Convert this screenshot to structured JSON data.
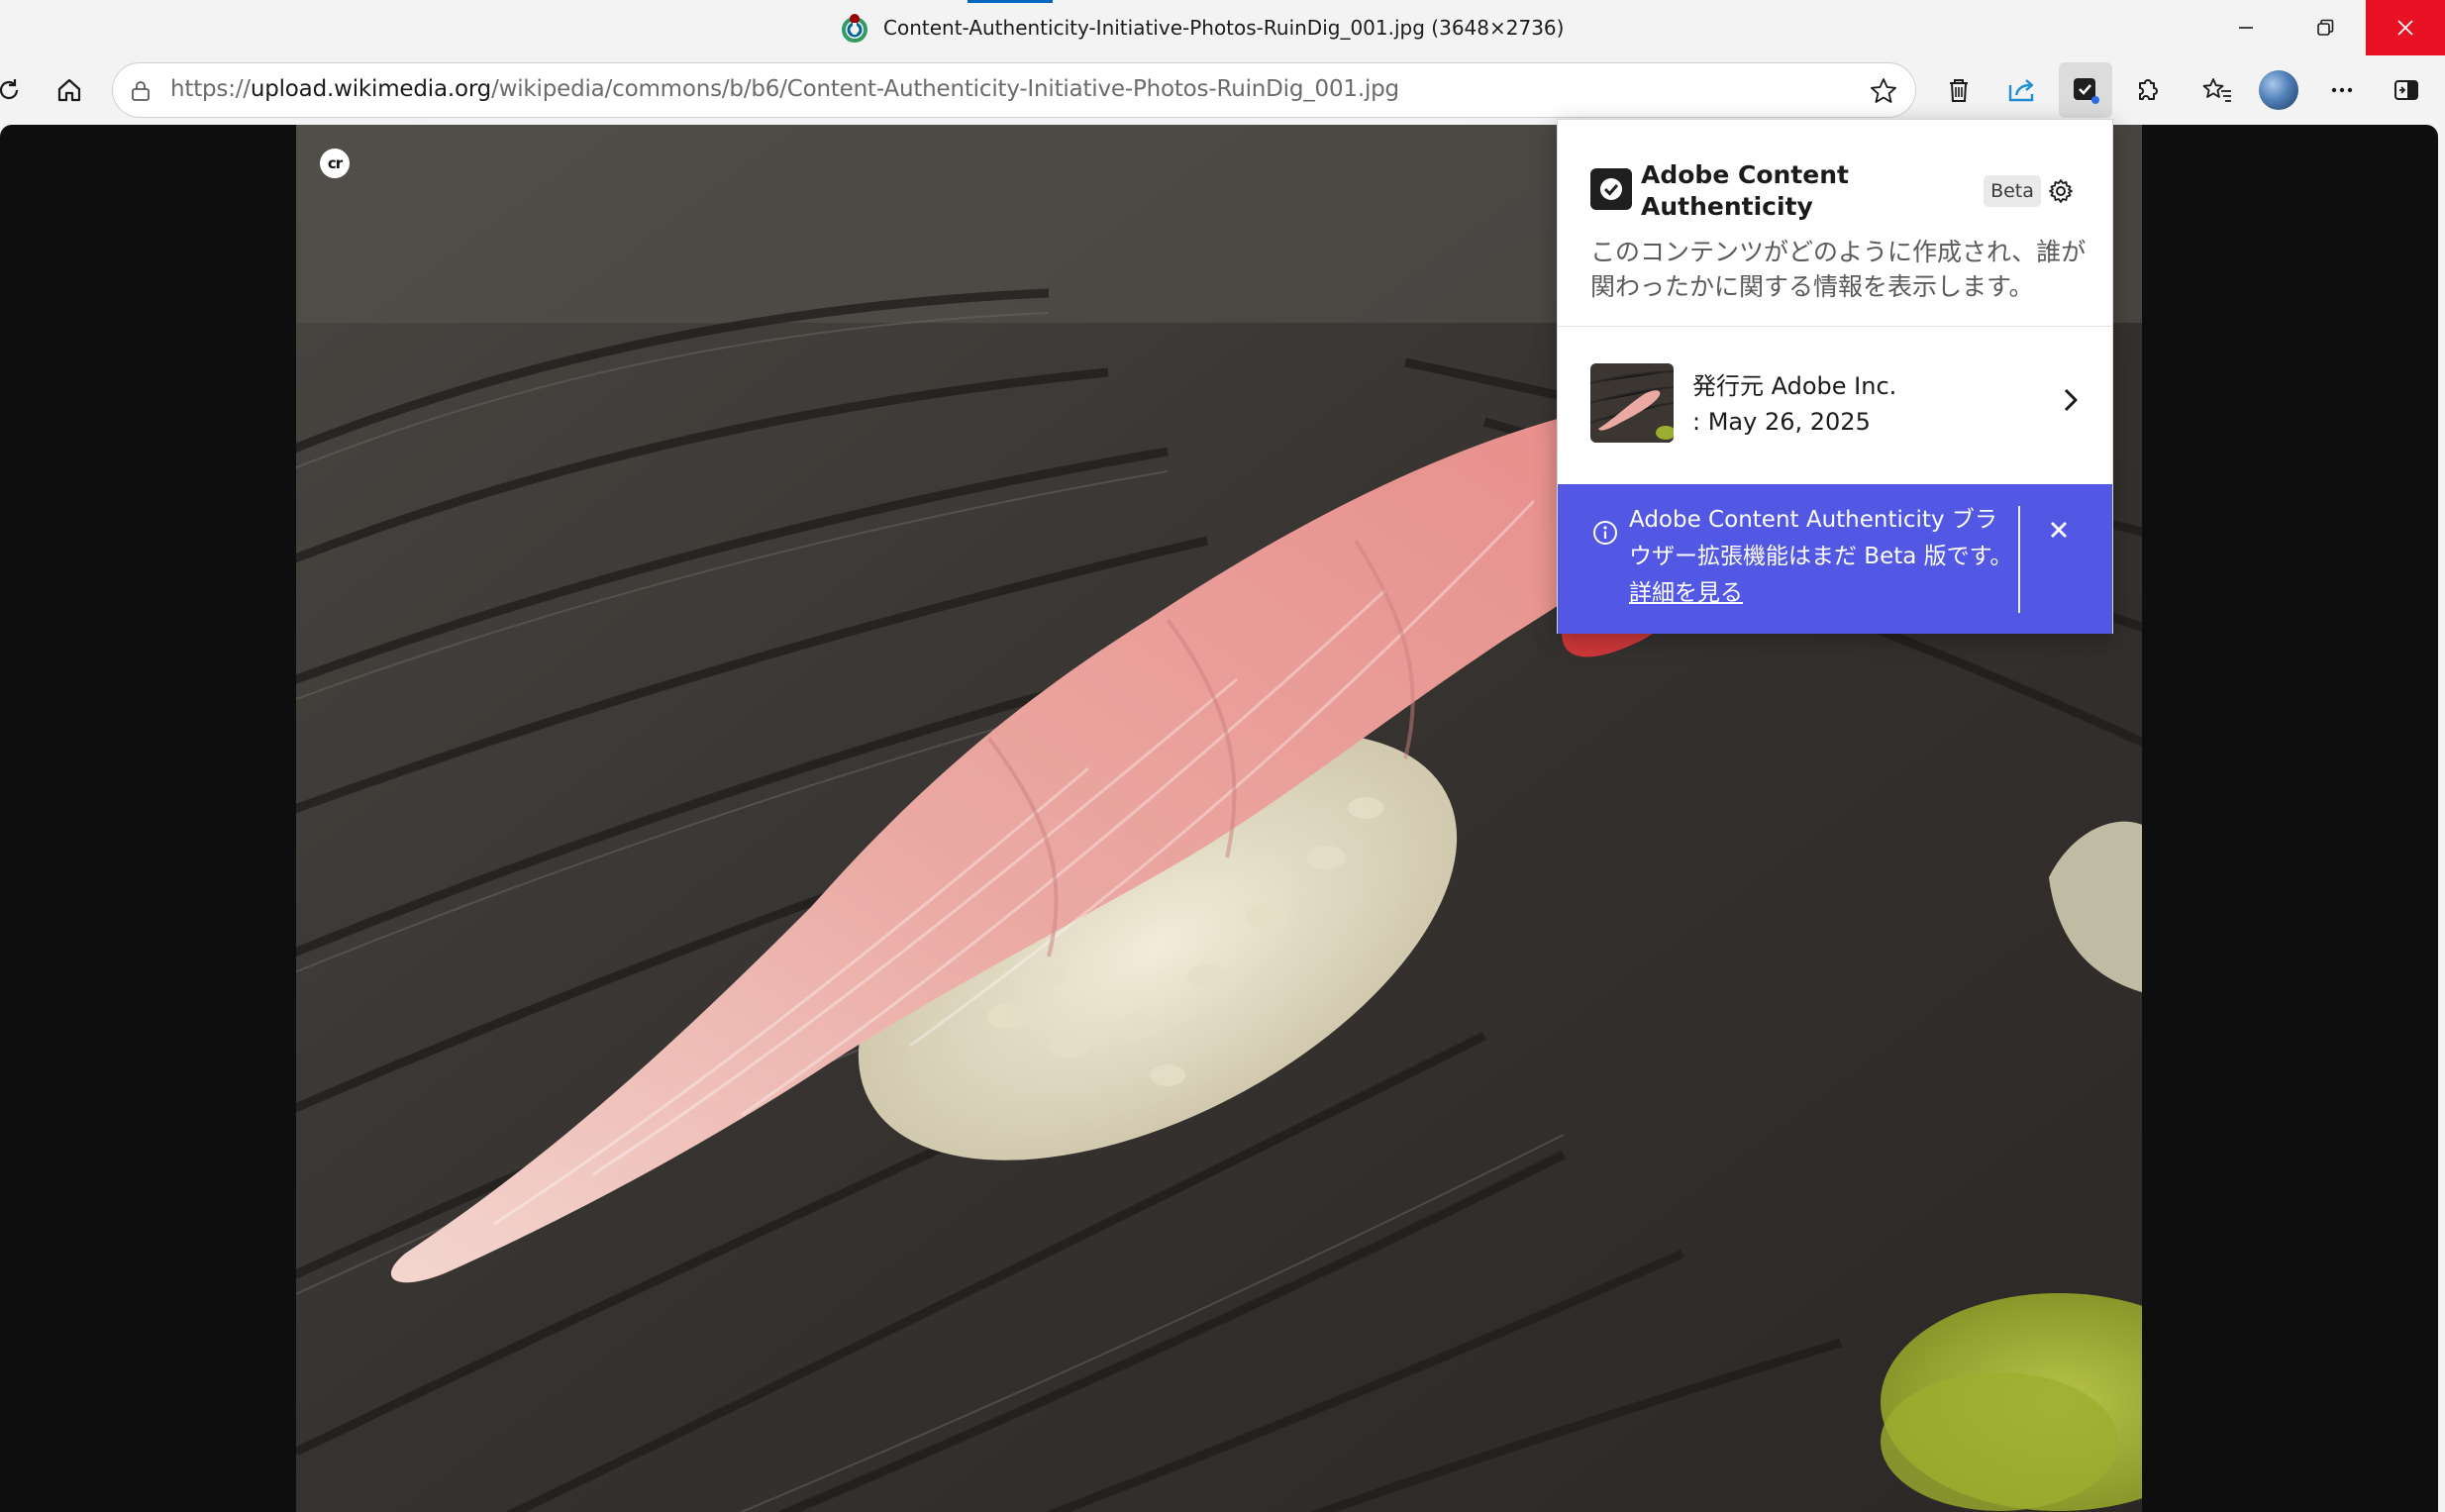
{
  "window": {
    "title": "Content-Authenticity-Initiative-Photos-RuinDig_001.jpg (3648×2736)"
  },
  "address_bar": {
    "url_scheme": "https://",
    "url_host": "upload.wikimedia.org",
    "url_path": "/wikipedia/commons/b/b6/Content-Authenticity-Initiative-Photos-RuinDig_001.jpg"
  },
  "toolbar_icons": [
    "reload-icon",
    "home-icon",
    "lock-icon",
    "star-icon",
    "trash-icon",
    "share-icon",
    "content-credentials-extension-icon",
    "extensions-icon",
    "favorites-icon",
    "profile-avatar",
    "more-icon",
    "sidebar-icon"
  ],
  "viewer": {
    "badge_label": "cr"
  },
  "popup": {
    "brand": "Adobe Content Authenticity",
    "beta_label": "Beta",
    "description": "このコンテンツがどのように作成され、誰が関わったかに関する情報を表示します。",
    "credential": {
      "issuer": "発行元 Adobe Inc.",
      "date": ": May 26, 2025"
    },
    "notice": {
      "message": "Adobe Content Authenticity ブラウザー拡張機能はまだ Beta 版です。",
      "link_label": "詳細を見る"
    }
  },
  "colors": {
    "accent": "#0067c0",
    "close_red": "#e81123",
    "notice_bg": "#5258e4"
  }
}
